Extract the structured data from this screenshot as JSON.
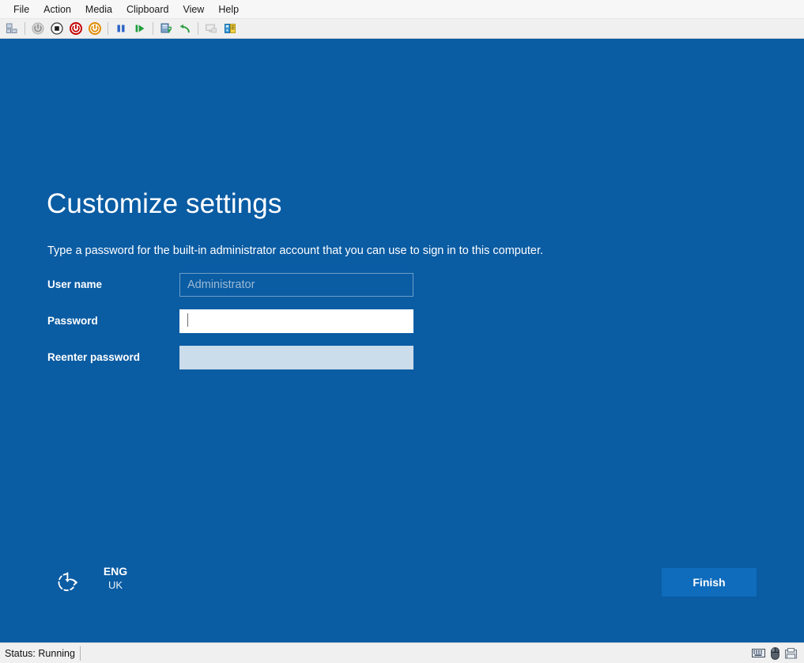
{
  "window": {
    "menu": [
      {
        "label": "File",
        "name": "menu-file"
      },
      {
        "label": "Action",
        "name": "menu-action"
      },
      {
        "label": "Media",
        "name": "menu-media"
      },
      {
        "label": "Clipboard",
        "name": "menu-clipboard"
      },
      {
        "label": "View",
        "name": "menu-view"
      },
      {
        "label": "Help",
        "name": "menu-help"
      }
    ],
    "toolbar": [
      {
        "name": "checkpoint-icon",
        "title": "Checkpoint"
      },
      {
        "name": "separator",
        "title": ""
      },
      {
        "name": "power-off-disabled-icon",
        "title": "Turn Off"
      },
      {
        "name": "shut-down-icon",
        "title": "Shut Down"
      },
      {
        "name": "power-red-icon",
        "title": "Turn Off"
      },
      {
        "name": "power-orange-icon",
        "title": "Start"
      },
      {
        "name": "separator",
        "title": ""
      },
      {
        "name": "pause-icon",
        "title": "Pause"
      },
      {
        "name": "resume-icon",
        "title": "Reset"
      },
      {
        "name": "separator",
        "title": ""
      },
      {
        "name": "snapshot-icon",
        "title": "Checkpoint"
      },
      {
        "name": "revert-icon",
        "title": "Revert"
      },
      {
        "name": "separator",
        "title": ""
      },
      {
        "name": "basic-session-icon",
        "title": "Basic Session"
      },
      {
        "name": "enhanced-session-icon",
        "title": "Enhanced Session"
      }
    ]
  },
  "oobe": {
    "title": "Customize settings",
    "subtitle": "Type a password for the built-in administrator account that you can use to sign in to this computer.",
    "fields": [
      {
        "label": "User name",
        "value": "Administrator",
        "state": "readonly",
        "name": "user-name"
      },
      {
        "label": "Password",
        "value": "",
        "state": "focused",
        "name": "password"
      },
      {
        "label": "Reenter password",
        "value": "",
        "state": "idle",
        "name": "reenter-password"
      }
    ],
    "ease_of_access_icon": "ease-of-access-icon",
    "language": {
      "main": "ENG",
      "sub": "UK"
    },
    "finish_label": "Finish",
    "colors": {
      "background": "#0a5ca3",
      "accent_button": "#0f6cbd",
      "field_idle": "#cbdcea",
      "field_readonly_border": "#6f9fc6"
    }
  },
  "statusbar": {
    "status": "Status: Running",
    "icons": [
      {
        "name": "keyboard-icon"
      },
      {
        "name": "mouse-icon"
      },
      {
        "name": "disk-icon"
      }
    ]
  }
}
